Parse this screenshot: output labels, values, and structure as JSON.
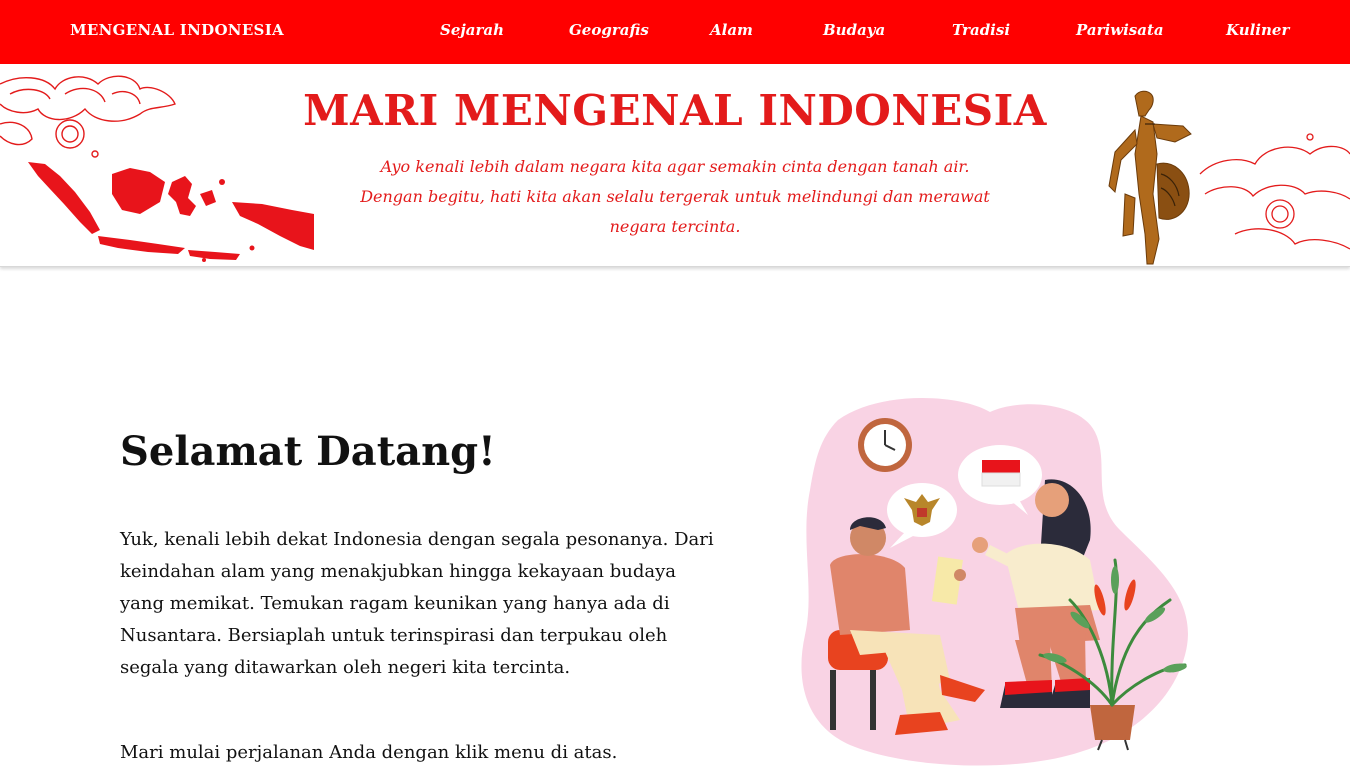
{
  "navbar": {
    "brand": "MENGENAL INDONESIA",
    "items": [
      {
        "label": "Sejarah"
      },
      {
        "label": "Geografis"
      },
      {
        "label": "Alam"
      },
      {
        "label": "Budaya"
      },
      {
        "label": "Tradisi"
      },
      {
        "label": "Pariwisata"
      },
      {
        "label": "Kuliner"
      }
    ]
  },
  "hero": {
    "title": "MARI MENGENAL INDONESIA",
    "subtitle_lines": [
      "Ayo kenali lebih dalam negara kita agar semakin cinta dengan tanah air.",
      "Dengan begitu, hati kita akan selalu tergerak untuk melindungi dan merawat",
      "negara tercinta."
    ]
  },
  "main": {
    "heading": "Selamat Datang!",
    "paragraph": "Yuk, kenali lebih dekat Indonesia dengan segala pesonanya. Dari keindahan alam yang menakjubkan hingga kekayaan budaya yang memikat. Temukan ragam keunikan yang hanya ada di Nusantara. Bersiaplah untuk terinspirasi dan terpukau oleh segala yang ditawarkan oleh negeri kita tercinta.",
    "cta": "Mari mulai perjalanan Anda dengan klik menu di atas."
  },
  "colors": {
    "brand_red": "#ff0000",
    "hero_text": "#e31b1b",
    "illustration_bg": "#f9d3e4"
  },
  "icons": {
    "hero_left": "indonesia-map-icon",
    "hero_right": "wayang-puppet-icon",
    "illustration": "two-people-talking-illustration"
  }
}
